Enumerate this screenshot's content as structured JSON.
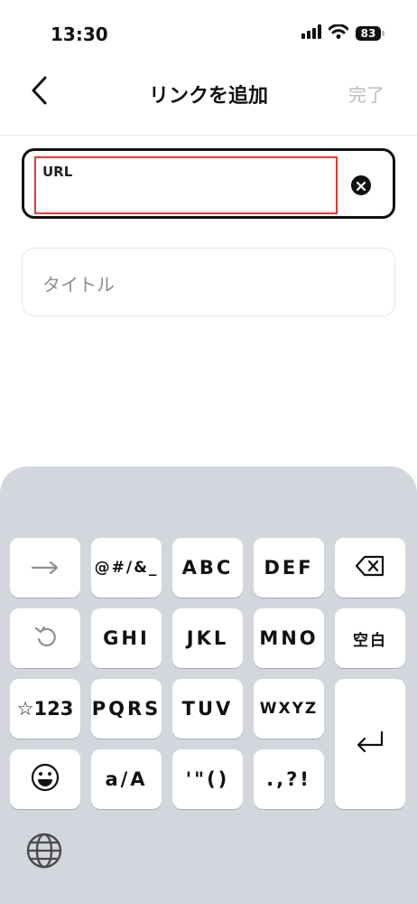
{
  "status_bar": {
    "time": "13:30",
    "battery": "83"
  },
  "nav": {
    "title": "リンクを追加",
    "done_label": "完了"
  },
  "form": {
    "url_label": "URL",
    "title_placeholder": "タイトル"
  },
  "keyboard": {
    "rows": [
      [
        "→",
        "@#/&_",
        "ABC",
        "DEF",
        "⌫"
      ],
      [
        "↺",
        "GHI",
        "JKL",
        "MNO",
        "空白"
      ],
      [
        "☆123",
        "PQRS",
        "TUV",
        "WXYZ",
        "⏎"
      ],
      [
        "😊",
        "a/A",
        "'\"()",
        ".,?!"
      ]
    ],
    "key_arrow": "→",
    "key_symbols": "@#/&_",
    "key_abc": "ABC",
    "key_def": "DEF",
    "key_ghi": "GHI",
    "key_jkl": "JKL",
    "key_mno": "MNO",
    "key_space": "空白",
    "key_num": "☆123",
    "key_pqrs": "PQRS",
    "key_tuv": "TUV",
    "key_wxyz": "WXYZ",
    "key_case": "a/A",
    "key_quotes": "'\"()",
    "key_punct": ".,?!"
  },
  "colors": {
    "highlight": "#e53935",
    "keyboard_bg": "#d3d6dc",
    "done_disabled": "#bcbcbc"
  },
  "icons": [
    "signal-icon",
    "wifi-icon",
    "battery-icon",
    "back-chevron-icon",
    "clear-icon",
    "backspace-icon",
    "undo-icon",
    "enter-icon",
    "emoji-icon",
    "globe-icon"
  ]
}
